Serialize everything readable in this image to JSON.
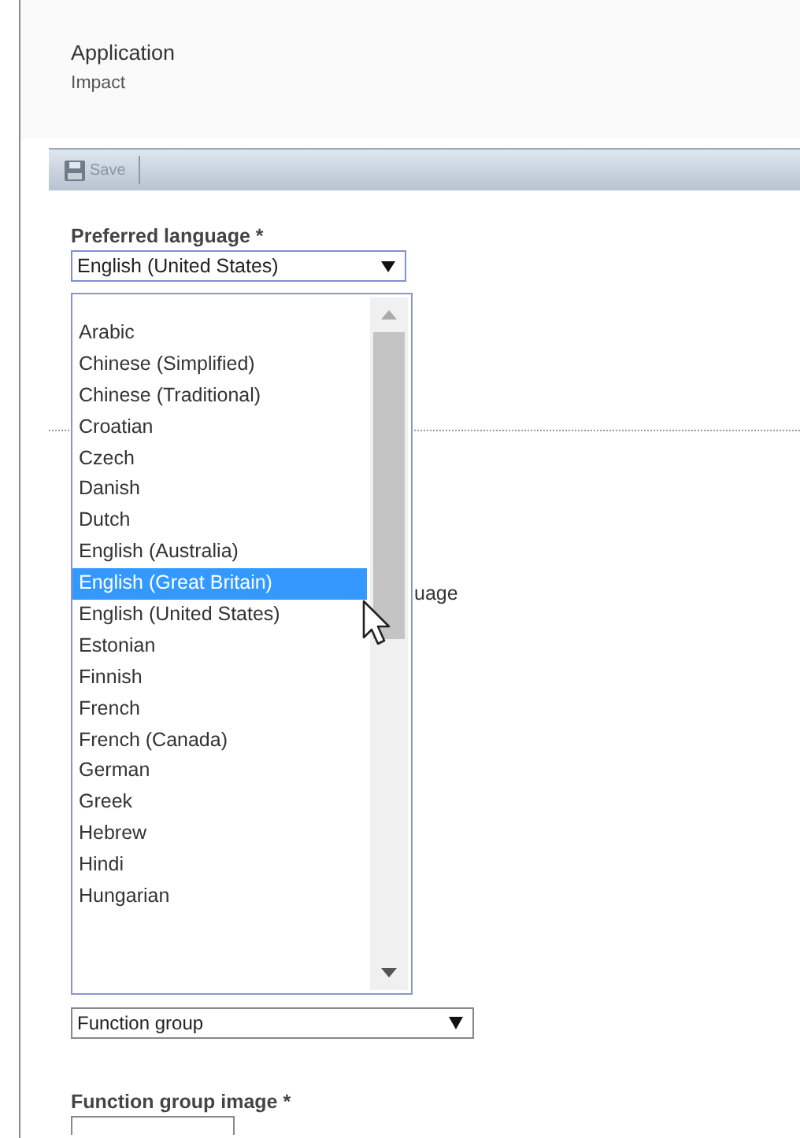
{
  "record": {
    "label": "Application",
    "value": "Impact"
  },
  "toolbar": {
    "buttons": [
      {
        "label": "Save",
        "disabled": true
      }
    ]
  },
  "preferred_language": {
    "label": "Preferred language *",
    "value": "English (United States)",
    "expanded": true,
    "options": [
      {
        "label": "Arabic",
        "highlighted": false
      },
      {
        "label": "Chinese (Simplified)",
        "highlighted": false
      },
      {
        "label": "Chinese (Traditional)",
        "highlighted": false
      },
      {
        "label": "Croatian",
        "highlighted": false
      },
      {
        "label": "Czech",
        "highlighted": false
      },
      {
        "label": "Danish",
        "highlighted": false
      },
      {
        "label": "Dutch",
        "highlighted": false
      },
      {
        "label": "English (Australia)",
        "highlighted": false
      },
      {
        "label": "English (Great Britain)",
        "highlighted": true
      },
      {
        "label": "English (United States)",
        "highlighted": false
      },
      {
        "label": "Estonian",
        "highlighted": false
      },
      {
        "label": "Finnish",
        "highlighted": false
      },
      {
        "label": "French",
        "highlighted": false
      },
      {
        "label": "French (Canada)",
        "highlighted": false
      },
      {
        "label": "German",
        "highlighted": false
      },
      {
        "label": "Greek",
        "highlighted": false
      },
      {
        "label": "Hebrew",
        "highlighted": false
      },
      {
        "label": "Hindi",
        "highlighted": false
      },
      {
        "label": "Hungarian",
        "highlighted": false
      }
    ]
  },
  "hidden_field_label": "uage",
  "function_group": {
    "value": "Function group"
  },
  "function_group_image": {
    "label": "Function group image *"
  }
}
